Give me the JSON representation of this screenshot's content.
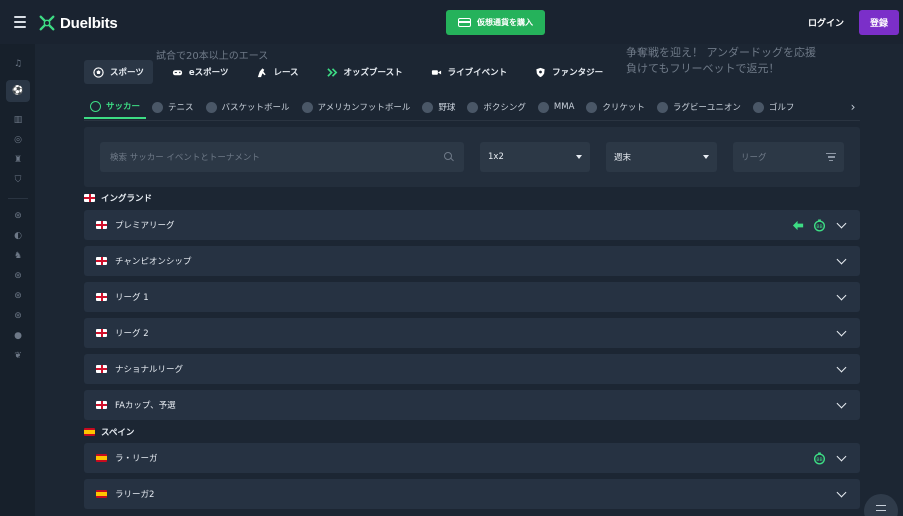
{
  "header": {
    "brand": "Duelbits",
    "buy_crypto": "仮想通貨を購入",
    "login": "ログイン",
    "register": "登録"
  },
  "promo": {
    "left": "試合で20本以上のエース",
    "right_line1": "争奪戦を迎え！ アンダードッグを応援",
    "right_line2": "負けてもフリーベットで返元！"
  },
  "categories": [
    {
      "label": "スポーツ",
      "icon": "soccer-ball-icon",
      "active": true
    },
    {
      "label": "eスポーツ",
      "icon": "gamepad-icon",
      "active": false
    },
    {
      "label": "レース",
      "icon": "horse-icon",
      "active": false
    },
    {
      "label": "オッズブースト",
      "icon": "boost-icon",
      "active": false
    },
    {
      "label": "ライブイベント",
      "icon": "video-camera-icon",
      "active": false
    },
    {
      "label": "ファンタジー",
      "icon": "shield-icon",
      "active": false
    }
  ],
  "sports": [
    {
      "label": "サッカー",
      "active": true
    },
    {
      "label": "テニス"
    },
    {
      "label": "バスケットボール"
    },
    {
      "label": "アメリカンフットボール"
    },
    {
      "label": "野球"
    },
    {
      "label": "ボクシング"
    },
    {
      "label": "MMA"
    },
    {
      "label": "クリケット"
    },
    {
      "label": "ラグビーユニオン"
    },
    {
      "label": "ゴルフ"
    }
  ],
  "filters": {
    "search_placeholder": "検索 サッカー イベントとトーナメント",
    "market": "1x2",
    "period": "週末",
    "league_placeholder": "リーグ"
  },
  "countries": {
    "england": "イングランド",
    "spain": "スペイン"
  },
  "leagues": {
    "premier": "プレミアリーグ",
    "championship": "チャンピオンシップ",
    "league1": "リーグ 1",
    "league2": "リーグ 2",
    "national": "ナショナルリーグ",
    "facup": "FAカップ、予選",
    "laliga": "ラ・リーガ",
    "laliga2": "ラリーガ2"
  },
  "colors": {
    "accent_green": "#3ddc84",
    "buy_button": "#25b25b",
    "register_button": "#7b2fc9",
    "background": "#1c2633"
  }
}
